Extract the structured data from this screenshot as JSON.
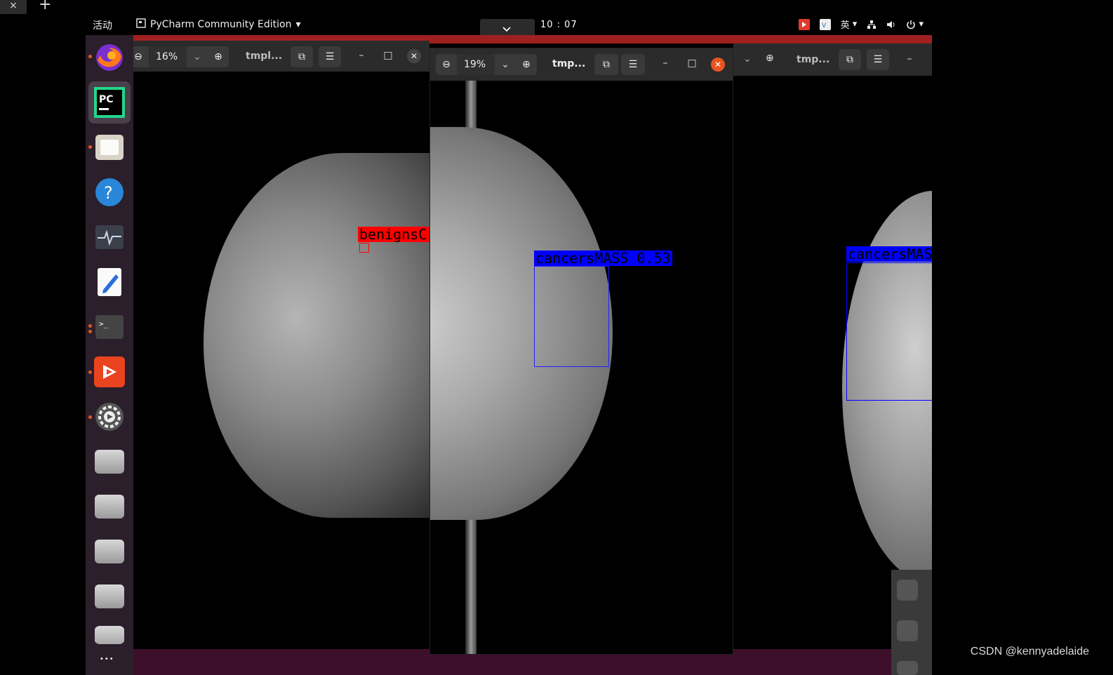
{
  "host": {
    "close": "×",
    "add": "+"
  },
  "topbar": {
    "activities": "活动",
    "app_menu": "PyCharm Community Edition",
    "clock": "10 : 07",
    "input_method": "英"
  },
  "dock": {
    "apps": [
      "firefox-icon",
      "pycharm-icon",
      "files-icon",
      "help-icon",
      "system-monitor-icon",
      "text-editor-icon",
      "terminal-icon",
      "anydesk-icon",
      "settings-icon",
      "drive-icon",
      "drive-icon",
      "drive-icon",
      "drive-icon",
      "drive-icon"
    ],
    "more": "•••",
    "pycharm_label": "PC"
  },
  "windows": [
    {
      "zoom": "16%",
      "title": "tmpl...",
      "label": "benignsC",
      "label_color": "#ff0000"
    },
    {
      "zoom": "19%",
      "title": "tmp...",
      "label": "cancersMASS 0.53",
      "label_color": "#0000ff"
    },
    {
      "zoom": "",
      "title": "tmp...",
      "label": "cancersMASS",
      "label_color": "#0000ff"
    }
  ],
  "watermark": "CSDN @kennyadelaide"
}
